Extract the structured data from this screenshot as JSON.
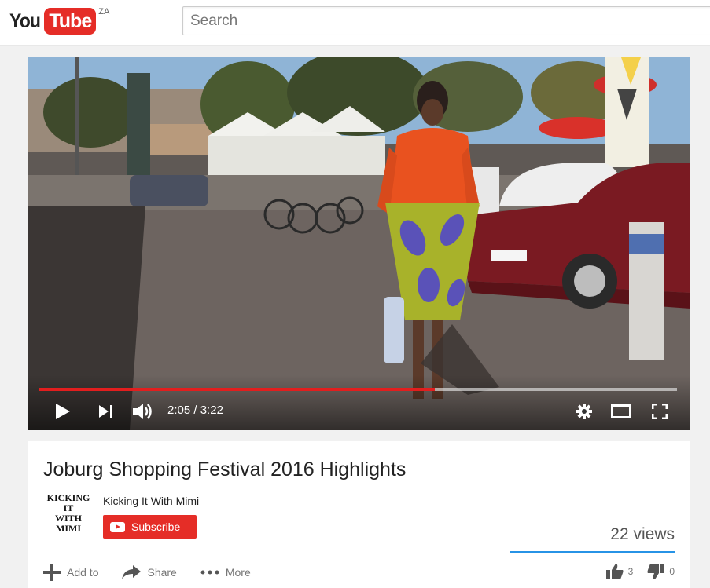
{
  "header": {
    "logo_you": "You",
    "logo_tube": "Tube",
    "region": "ZA",
    "search_placeholder": "Search"
  },
  "player": {
    "current_time": "2:05",
    "duration": "3:22",
    "time_separator": " / ",
    "progress_fraction": 0.62,
    "progress_color": "#e21e1e"
  },
  "video": {
    "title": "Joburg Shopping Festival 2016 Highlights",
    "channel_name": "Kicking It With Mimi",
    "channel_logo_lines": [
      "KICKING",
      "IT",
      "WITH",
      "MIMI"
    ],
    "subscribe_label": "Subscribe",
    "views": "22 views",
    "likes": "3",
    "dislikes": "0"
  },
  "actions": {
    "add_to": "Add to",
    "share": "Share",
    "more": "More"
  },
  "icons": [
    "play-icon",
    "next-icon",
    "volume-icon",
    "settings-icon",
    "theater-icon",
    "fullscreen-icon",
    "plus-icon",
    "share-arrow-icon",
    "more-dots-icon",
    "thumbs-up-icon",
    "thumbs-down-icon"
  ],
  "colors": {
    "brand_red": "#e52d27",
    "views_bar": "#2793e6"
  }
}
